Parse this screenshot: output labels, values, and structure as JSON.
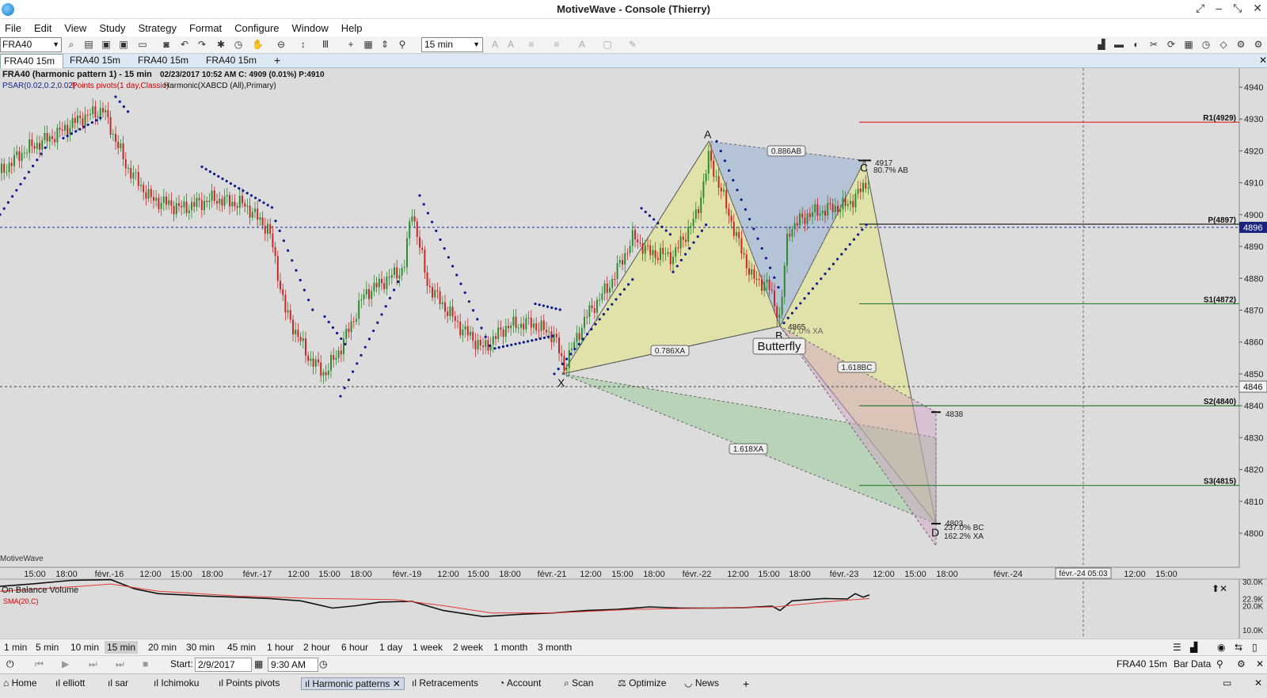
{
  "window": {
    "title": "MotiveWave - Console (Thierry)"
  },
  "menu": [
    "File",
    "Edit",
    "View",
    "Study",
    "Strategy",
    "Format",
    "Configure",
    "Window",
    "Help"
  ],
  "toolbar": {
    "symbol": "FRA40",
    "interval": "15 min"
  },
  "tabs": [
    "FRA40 15m",
    "FRA40 15m",
    "FRA40 15m",
    "FRA40 15m"
  ],
  "chart": {
    "header_title": "FRA40 (harmonic pattern 1) - 15 min",
    "header_info": "02/23/2017 10:52 AM  C: 4909 (0.01%) P:4910",
    "studies": [
      "PSAR(0.02,0.2,0.02)",
      "Points pivots(1 day,Classic)",
      "Harmonic(XABCD (All),Primary)"
    ],
    "watermark": "MotiveWave",
    "price_ticks": [
      "4940",
      "4930",
      "4920",
      "4910",
      "4900",
      "4890",
      "4880",
      "4870",
      "4860",
      "4850",
      "4840",
      "4830",
      "4820",
      "4810",
      "4800"
    ],
    "current_price": "4896",
    "crosshair_price": "4846",
    "time_ticks": [
      "15:00",
      "18:00",
      "févr.-16",
      "12:00",
      "15:00",
      "18:00",
      "févr.-17",
      "12:00",
      "15:00",
      "18:00",
      "févr.-19",
      "12:00",
      "15:00",
      "18:00",
      "févr.-21",
      "12:00",
      "15:00",
      "18:00",
      "févr.-22",
      "12:00",
      "15:00",
      "18:00",
      "févr.-23",
      "12:00",
      "15:00",
      "18:00",
      "févr.-24",
      "9:00",
      "12:00",
      "15:00"
    ],
    "crosshair_time": "févr.-24 05:03",
    "pivots": {
      "R1": "R1(4929)",
      "P": "P(4897)",
      "S1": "S1(4872)",
      "S2": "S2(4840)",
      "S3": "S3(4815)"
    },
    "pattern": {
      "name": "Butterfly",
      "points": {
        "X": "X",
        "A": "A",
        "B": "B",
        "C": "C",
        "D": "D"
      },
      "ratios": {
        "xb": "0.786XA",
        "ac": "0.886AB",
        "xd": "1.618XA",
        "bd": "1.618BC"
      },
      "labels": {
        "c_price": "4917",
        "c_ratio": "80.7% AB",
        "b_price": "4865",
        "b_ratio": "77.0% XA",
        "target": "4838",
        "d_price": "4803",
        "d_ratio_bc": "237.0% BC",
        "d_ratio_xa": "162.2% XA"
      }
    },
    "indicator": {
      "title": "On Balance Volume",
      "sub": "SMA(20,C)",
      "ticks": [
        "30.0K",
        "22.9K",
        "20.0K",
        "10.0K"
      ]
    }
  },
  "intervals": [
    "1 min",
    "5 min",
    "10 min",
    "15 min",
    "20 min",
    "30 min",
    "45 min",
    "1 hour",
    "2 hour",
    "6 hour",
    "1 day",
    "1 week",
    "2 week",
    "1 month",
    "3 month"
  ],
  "replay": {
    "start_label": "Start:",
    "start_date": "2/9/2017",
    "start_time": "9:30 AM",
    "right_label": "FRA40 15m",
    "bar_data": "Bar Data"
  },
  "pages": [
    "Home",
    "elliott",
    "sar",
    "Ichimoku",
    "Points pivots",
    "Harmonic patterns",
    "Retracements",
    "Account",
    "Scan",
    "Optimize",
    "News"
  ]
}
